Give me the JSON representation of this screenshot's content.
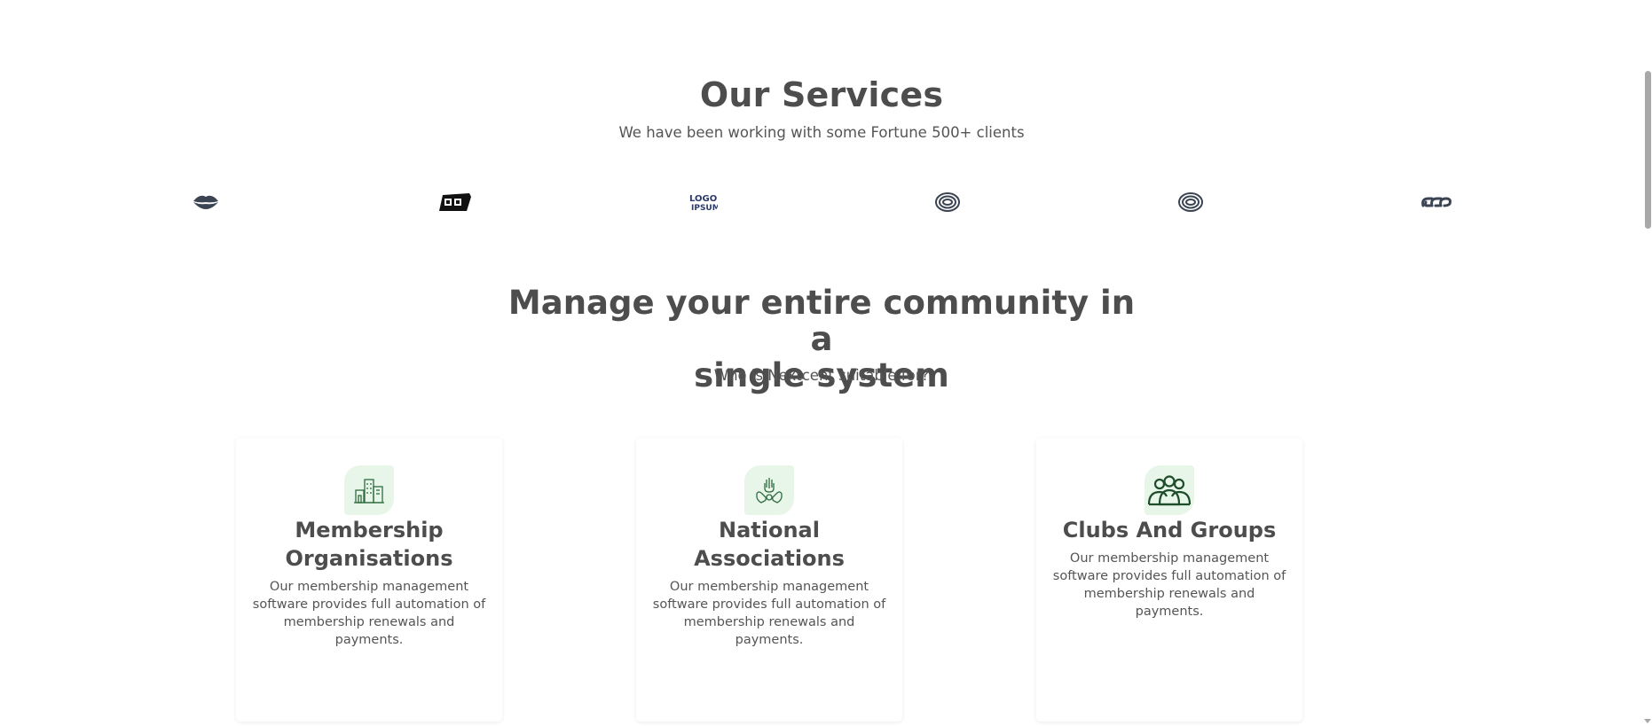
{
  "services": {
    "title": "Our Services",
    "subtitle": "We have been working with some Fortune 500+ clients"
  },
  "client_logos": [
    {
      "icon": "client-logo-lips-icon"
    },
    {
      "icon": "client-logo-box-icon"
    },
    {
      "icon": "client-logo-logoipsum-icon",
      "text": "LOGO IPSUM"
    },
    {
      "icon": "client-logo-rings-icon"
    },
    {
      "icon": "client-logo-rings-icon"
    },
    {
      "icon": "client-logo-chain-icon"
    }
  ],
  "community": {
    "title_line1": "Manage your entire community in a",
    "title_line2": "single system",
    "subtitle": "Who is Nextcent suitable for?"
  },
  "cards": [
    {
      "icon": "building-icon",
      "title_line1": "Membership",
      "title_line2": "Organisations",
      "desc_line1": "Our membership management",
      "desc_line2": "software provides full automation of",
      "desc_line3": "membership renewals and payments."
    },
    {
      "icon": "hands-icon",
      "title_line1": "National",
      "title_line2": "Associations",
      "desc_line1": "Our membership management",
      "desc_line2": "software provides full automation of",
      "desc_line3": "membership renewals and payments."
    },
    {
      "icon": "group-icon",
      "title_line1": "Clubs And Groups",
      "desc_line1": "Our membership management",
      "desc_line2": "software provides full automation of",
      "desc_line3": "membership renewals and payments."
    }
  ],
  "colors": {
    "heading": "#4d4d4d",
    "icon_bg": "#e8f5e9",
    "icon_stroke": "#2e6b3f"
  }
}
